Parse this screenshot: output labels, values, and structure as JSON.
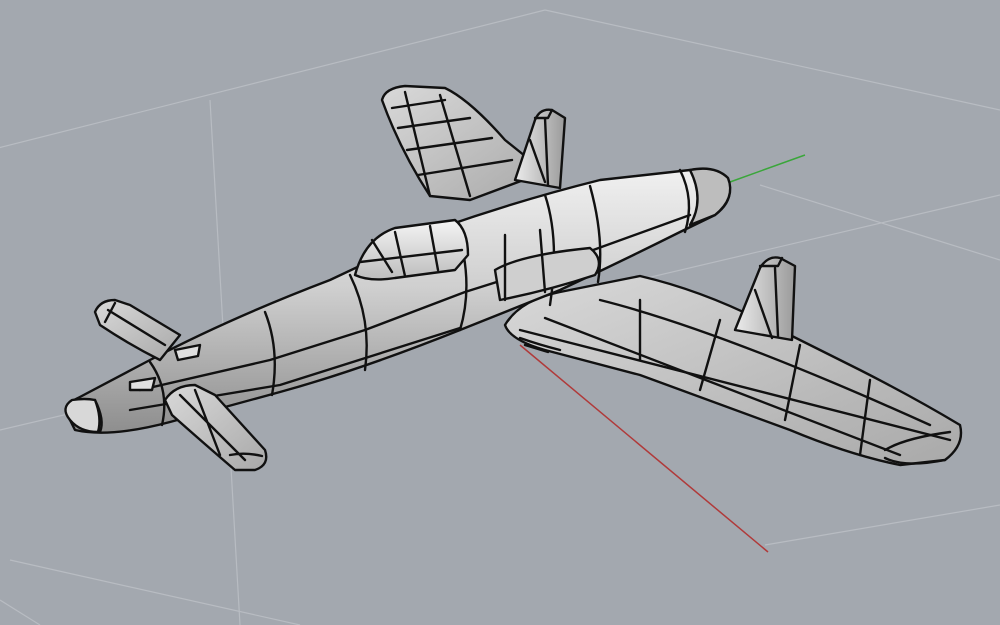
{
  "viewport": {
    "projection": "perspective",
    "background_color": "#a3a8af",
    "grid_color": "#b8bcc2",
    "x_axis_color": "#b03a3a",
    "y_axis_color": "#3aa63a",
    "model": {
      "name": "jet-aircraft",
      "display_mode": "shaded",
      "surface_color": "#c9c9c9",
      "edge_color": "#111111"
    }
  }
}
